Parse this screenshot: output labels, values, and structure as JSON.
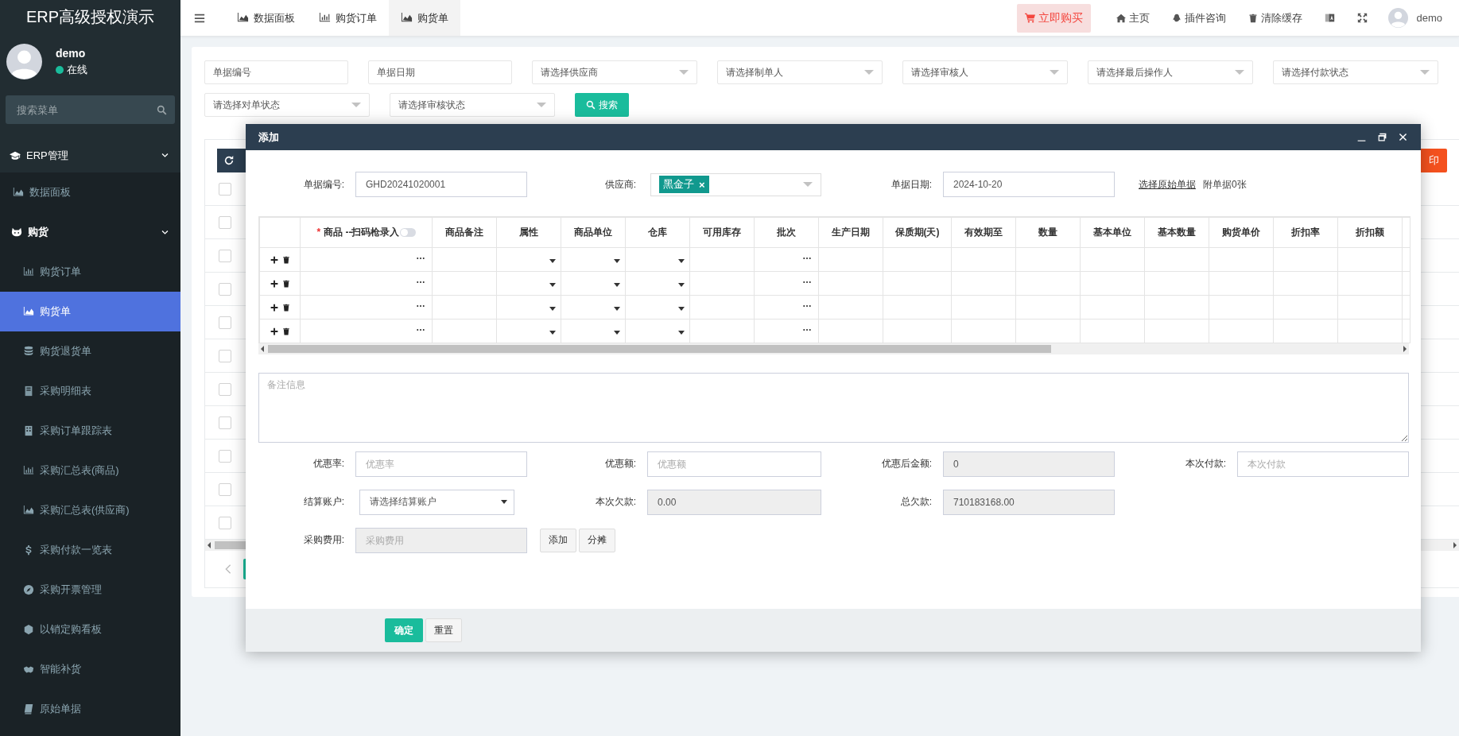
{
  "sidebar": {
    "title": "ERP高级授权演示",
    "user": {
      "name": "demo",
      "status": "在线",
      "online": true
    },
    "search": {
      "placeholder": "搜索菜单"
    },
    "menu": [
      {
        "label": "ERP管理",
        "expanded": true,
        "selected": false,
        "children": [
          {
            "label": "数据面板",
            "selected": false
          },
          {
            "label": "购货",
            "expanded": true,
            "selected": false,
            "children": [
              {
                "label": "购货订单",
                "selected": false
              },
              {
                "label": "购货单",
                "selected": true
              },
              {
                "label": "购货退货单",
                "selected": false
              },
              {
                "label": "采购明细表",
                "selected": false
              },
              {
                "label": "采购订单跟踪表",
                "selected": false
              },
              {
                "label": "采购汇总表(商品)",
                "selected": false
              },
              {
                "label": "采购汇总表(供应商)",
                "selected": false
              },
              {
                "label": "采购付款一览表",
                "selected": false
              },
              {
                "label": "采购开票管理",
                "selected": false
              },
              {
                "label": "以销定购看板",
                "selected": false
              },
              {
                "label": "智能补货",
                "selected": false
              },
              {
                "label": "原始单据",
                "selected": false
              }
            ]
          }
        ]
      }
    ]
  },
  "topbar": {
    "tabs": [
      {
        "label": "数据面板",
        "selected": false
      },
      {
        "label": "购货订单",
        "selected": false
      },
      {
        "label": "购货单",
        "selected": true
      }
    ],
    "buy_button": "立即购买",
    "links": [
      "主页",
      "插件咨询",
      "清除缓存"
    ],
    "user": "demo"
  },
  "filters": [
    {
      "kind": "input",
      "placeholder": "单据编号"
    },
    {
      "kind": "input",
      "placeholder": "单据日期"
    },
    {
      "kind": "select",
      "placeholder": "请选择供应商"
    },
    {
      "kind": "select",
      "placeholder": "请选择制单人"
    },
    {
      "kind": "select",
      "placeholder": "请选择审核人"
    },
    {
      "kind": "select",
      "placeholder": "请选择最后操作人"
    },
    {
      "kind": "select",
      "placeholder": "请选择付款状态"
    },
    {
      "kind": "select",
      "placeholder": "请选择对单状态"
    },
    {
      "kind": "select",
      "placeholder": "请选择审核状态"
    }
  ],
  "search_button": "搜索",
  "list": {
    "print_button": "印",
    "rows": [
      {
        "checked": false
      },
      {
        "checked": false
      },
      {
        "checked": false
      },
      {
        "checked": false
      },
      {
        "checked": false
      },
      {
        "checked": false
      },
      {
        "checked": false
      },
      {
        "checked": false
      },
      {
        "checked": false
      },
      {
        "checked": false
      },
      {
        "checked": false
      }
    ]
  },
  "dialog": {
    "title": "添加",
    "header_fields": [
      {
        "kind": "input",
        "label": "单据编号:",
        "value": "GHD20241020001"
      },
      {
        "kind": "tag-select",
        "label": "供应商:",
        "tag": "黑金子",
        "remove": "×"
      },
      {
        "kind": "input",
        "label": "单据日期:",
        "value": "2024-10-20"
      },
      {
        "kind": "link",
        "link": "选择原始单据",
        "note": "附单据0张"
      }
    ],
    "table": {
      "columns": [
        {
          "label": "商品 --扫码枪录入",
          "required_mark": "*",
          "scan_toggle": {
            "on": false
          },
          "kind": "picker"
        },
        {
          "label": "商品备注",
          "kind": "text"
        },
        {
          "label": "属性",
          "kind": "select"
        },
        {
          "label": "商品单位",
          "kind": "select"
        },
        {
          "label": "仓库",
          "kind": "select"
        },
        {
          "label": "可用库存",
          "kind": "text"
        },
        {
          "label": "批次",
          "kind": "picker"
        },
        {
          "label": "生产日期",
          "kind": "text"
        },
        {
          "label": "保质期(天)",
          "kind": "text"
        },
        {
          "label": "有效期至",
          "kind": "text"
        },
        {
          "label": "数量",
          "kind": "text"
        },
        {
          "label": "基本单位",
          "kind": "text"
        },
        {
          "label": "基本数量",
          "kind": "text"
        },
        {
          "label": "购货单价",
          "kind": "text"
        },
        {
          "label": "折扣率",
          "kind": "text"
        },
        {
          "label": "折扣额",
          "kind": "text"
        }
      ],
      "rows": [
        {
          "kind": "empty"
        },
        {
          "kind": "empty"
        },
        {
          "kind": "empty"
        },
        {
          "kind": "empty"
        }
      ]
    },
    "remark": {
      "placeholder": "备注信息"
    },
    "form_rows": [
      [
        {
          "kind": "input",
          "label": "优惠率:",
          "placeholder": "优惠率",
          "disabled": false
        },
        {
          "kind": "input",
          "label": "优惠额:",
          "placeholder": "优惠额",
          "disabled": false
        },
        {
          "kind": "input",
          "label": "优惠后金额:",
          "value": "0",
          "disabled": true
        },
        {
          "kind": "input",
          "label": "本次付款:",
          "placeholder": "本次付款",
          "disabled": false
        }
      ],
      [
        {
          "kind": "select",
          "label": "结算账户:",
          "value": "请选择结算账户"
        },
        {
          "kind": "input",
          "label": "本次欠款:",
          "value": "0.00",
          "disabled": true
        },
        {
          "kind": "input",
          "label": "总欠款:",
          "value": "710183168.00",
          "disabled": true
        }
      ],
      [
        {
          "kind": "input",
          "label": "采购费用:",
          "placeholder": "采购费用",
          "disabled": true
        },
        {
          "kind": "buttons",
          "buttons": [
            "添加",
            "分摊"
          ]
        }
      ]
    ],
    "confirm_button": "确定",
    "reset_button": "重置"
  }
}
